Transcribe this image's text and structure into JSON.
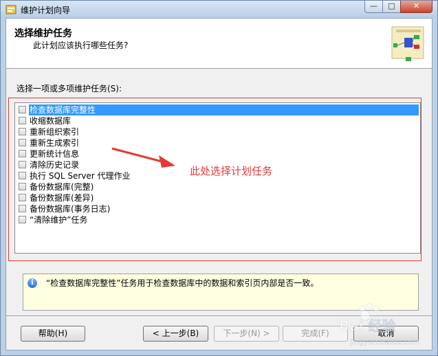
{
  "window": {
    "title": "维护计划向导"
  },
  "header": {
    "title": "选择维护任务",
    "subtitle": "此计划应该执行哪些任务?"
  },
  "task_list": {
    "label": "选择一项或多项维护任务(S):",
    "items": [
      {
        "label": "检查数据库完整性",
        "selected": true,
        "checked": false
      },
      {
        "label": "收缩数据库",
        "selected": false,
        "checked": false
      },
      {
        "label": "重新组织索引",
        "selected": false,
        "checked": false
      },
      {
        "label": "重新生成索引",
        "selected": false,
        "checked": false
      },
      {
        "label": "更新统计信息",
        "selected": false,
        "checked": false
      },
      {
        "label": "清除历史记录",
        "selected": false,
        "checked": false
      },
      {
        "label": "执行 SQL Server 代理作业",
        "selected": false,
        "checked": false
      },
      {
        "label": "备份数据库(完整)",
        "selected": false,
        "checked": false
      },
      {
        "label": "备份数据库(差异)",
        "selected": false,
        "checked": false
      },
      {
        "label": "备份数据库(事务日志)",
        "selected": false,
        "checked": false
      },
      {
        "label": "“清除维护”任务",
        "selected": false,
        "checked": false
      }
    ]
  },
  "annotation": {
    "text": "此处选择计划任务",
    "color": "#e53935"
  },
  "description": {
    "text": "“检查数据库完整性”任务用于检查数据库中的数据和索引页内部是否一致。"
  },
  "buttons": {
    "help": "帮助(H)",
    "back": "< 上一步(B)",
    "next": "下一步(N) >",
    "finish": "完成(F)",
    "cancel": "取消"
  },
  "watermark": {
    "text": "Bai 经验",
    "url_text": "jingyan.baidu.com"
  },
  "colors": {
    "selection": "#3399ff",
    "desc_bg": "#ffffe1",
    "annotation_red": "#e53935"
  }
}
